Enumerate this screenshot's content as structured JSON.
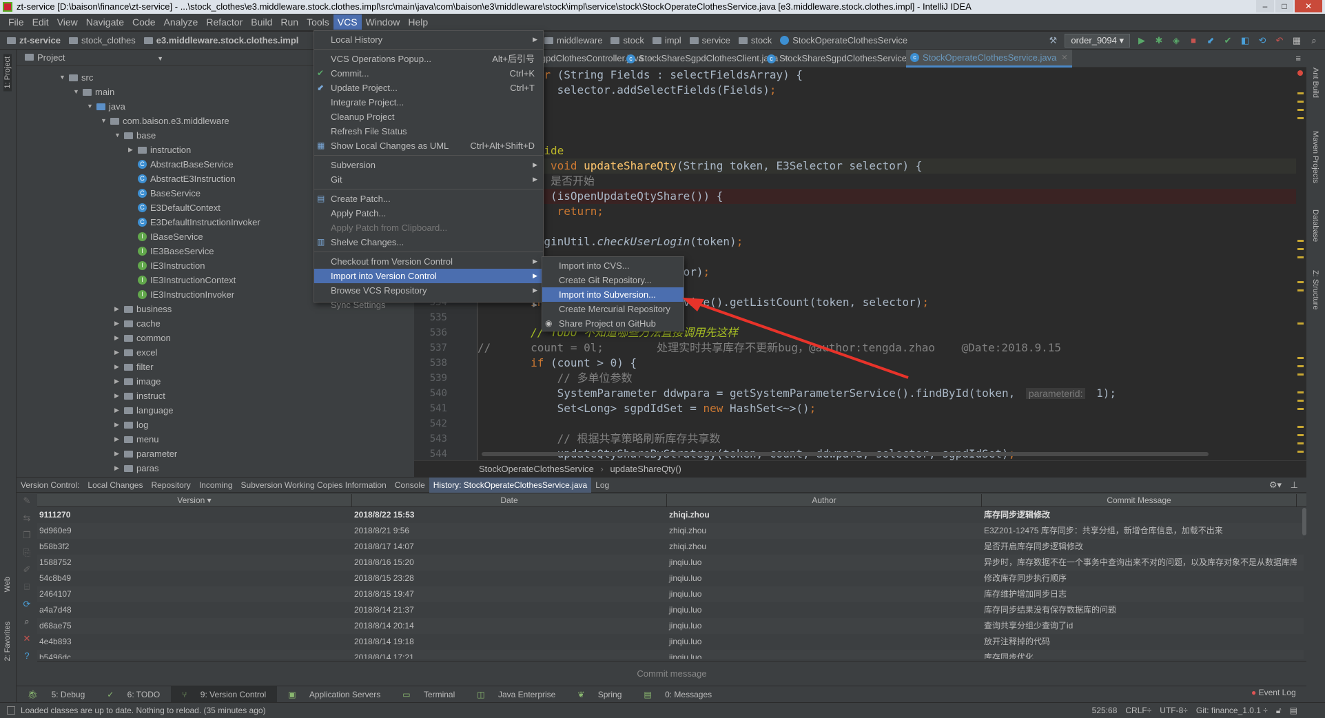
{
  "window": {
    "title": "zt-service [D:\\baison\\finance\\zt-service] - ...\\stock_clothes\\e3.middleware.stock.clothes.impl\\src\\main\\java\\com\\baison\\e3\\middleware\\stock\\impl\\service\\stock\\StockOperateClothesService.java [e3.middleware.stock.clothes.impl] - IntelliJ IDEA"
  },
  "menubar": [
    "File",
    "Edit",
    "View",
    "Navigate",
    "Code",
    "Analyze",
    "Refactor",
    "Build",
    "Run",
    "Tools",
    "VCS",
    "Window",
    "Help"
  ],
  "navbar": {
    "left": [
      "zt-service",
      "stock_clothes",
      "e3.middleware.stock.clothes.impl"
    ],
    "right": [
      "middleware",
      "stock",
      "impl",
      "service",
      "stock",
      "StockOperateClothesService"
    ],
    "run_config": "order_9094"
  },
  "project": {
    "header": "Project",
    "tool_label": "1: Project",
    "tree": [
      {
        "label": "src",
        "depth": 0,
        "arrow": "open",
        "icon": "folder"
      },
      {
        "label": "main",
        "depth": 1,
        "arrow": "open",
        "icon": "folder"
      },
      {
        "label": "java",
        "depth": 2,
        "arrow": "open",
        "icon": "folder-src"
      },
      {
        "label": "com.baison.e3.middleware",
        "depth": 3,
        "arrow": "open",
        "icon": "package"
      },
      {
        "label": "base",
        "depth": 4,
        "arrow": "open",
        "icon": "package"
      },
      {
        "label": "instruction",
        "depth": 5,
        "arrow": "closed",
        "icon": "package"
      },
      {
        "label": "AbstractBaseService",
        "depth": 5,
        "icon": "abstract-class"
      },
      {
        "label": "AbstractE3Instruction",
        "depth": 5,
        "icon": "abstract-class"
      },
      {
        "label": "BaseService",
        "depth": 5,
        "icon": "abstract-class"
      },
      {
        "label": "E3DefaultContext",
        "depth": 5,
        "icon": "class"
      },
      {
        "label": "E3DefaultInstructionInvoker",
        "depth": 5,
        "icon": "class"
      },
      {
        "label": "IBaseService",
        "depth": 5,
        "icon": "interface"
      },
      {
        "label": "IE3BaseService",
        "depth": 5,
        "icon": "interface"
      },
      {
        "label": "IE3Instruction",
        "depth": 5,
        "icon": "interface"
      },
      {
        "label": "IE3InstructionContext",
        "depth": 5,
        "icon": "interface"
      },
      {
        "label": "IE3InstructionInvoker",
        "depth": 5,
        "icon": "interface"
      },
      {
        "label": "business",
        "depth": 4,
        "arrow": "closed",
        "icon": "package"
      },
      {
        "label": "cache",
        "depth": 4,
        "arrow": "closed",
        "icon": "package"
      },
      {
        "label": "common",
        "depth": 4,
        "arrow": "closed",
        "icon": "package"
      },
      {
        "label": "excel",
        "depth": 4,
        "arrow": "closed",
        "icon": "package"
      },
      {
        "label": "filter",
        "depth": 4,
        "arrow": "closed",
        "icon": "package"
      },
      {
        "label": "image",
        "depth": 4,
        "arrow": "closed",
        "icon": "package"
      },
      {
        "label": "instruct",
        "depth": 4,
        "arrow": "closed",
        "icon": "package"
      },
      {
        "label": "language",
        "depth": 4,
        "arrow": "closed",
        "icon": "package"
      },
      {
        "label": "log",
        "depth": 4,
        "arrow": "closed",
        "icon": "package"
      },
      {
        "label": "menu",
        "depth": 4,
        "arrow": "closed",
        "icon": "package"
      },
      {
        "label": "parameter",
        "depth": 4,
        "arrow": "closed",
        "icon": "package"
      },
      {
        "label": "paras",
        "depth": 4,
        "arrow": "closed",
        "icon": "package"
      }
    ]
  },
  "editor": {
    "tabs": [
      {
        "label": "...ava",
        "active": false
      },
      {
        "label": "StockShareSgpdClothesController.java",
        "active": false
      },
      {
        "label": "StockShareSgpdClothesClient.java",
        "active": false
      },
      {
        "label": "StockShareSgpdClothesService.java",
        "active": false
      },
      {
        "label": "StockOperateClothesService.java",
        "active": true
      }
    ],
    "lines": [
      {
        "n": 519,
        "t": "        for (String Fields : selectFieldsArray) {"
      },
      {
        "n": 520,
        "t": "            selector.addSelectFields(Fields);"
      },
      {
        "n": 521,
        "t": "        }"
      },
      {
        "n": 522,
        "t": "    }"
      },
      {
        "n": 523,
        "t": ""
      },
      {
        "n": 524,
        "t": "    @Override"
      },
      {
        "n": 525,
        "t": "    public void updateShareQty(String token, E3Selector selector) {",
        "current": true
      },
      {
        "n": 526,
        "t": "        // 是否开始"
      },
      {
        "n": 527,
        "t": "        if (isOpenUpdateQtyShare()) {",
        "breakpoint": true
      },
      {
        "n": 528,
        "t": "            return;"
      },
      {
        "n": 529,
        "t": "        }"
      },
      {
        "n": 530,
        "t": "        LoginUtil.checkUserLogin(token);"
      },
      {
        "n": 531,
        "t": ""
      },
      {
        "n": 532,
        "t": "        validateSelector(selector);"
      },
      {
        "n": 533,
        "t": ""
      },
      {
        "n": 534,
        "t": "        int count = getStockService().getListCount(token, selector);"
      },
      {
        "n": 535,
        "t": ""
      },
      {
        "n": 536,
        "t": "        // TODO 不知道哪些方法直接调用先这样"
      },
      {
        "n": 537,
        "t": "//      count = 0l;        处理实时共享库存不更新bug，@author:tengda.zhao    @Date:2018.9.15"
      },
      {
        "n": 538,
        "t": "        if (count > 0) {"
      },
      {
        "n": 539,
        "t": "            // 多单位参数"
      },
      {
        "n": 540,
        "t": "            SystemParameter ddwpara = getSystemParameterService().findById(token, ",
        "hint": "parameterid:",
        "after": " 1);"
      },
      {
        "n": 541,
        "t": "            Set<Long> sgpdIdSet = new HashSet<~>();"
      },
      {
        "n": 542,
        "t": ""
      },
      {
        "n": 543,
        "t": "            // 根据共享策略刷新库存共享数"
      },
      {
        "n": 544,
        "t": "            updateQtyShareByStrategy(token, count, ddwpara, selector, sgpdIdSet);"
      }
    ],
    "breadcrumb": [
      "StockOperateClothesService",
      "updateShareQty()"
    ]
  },
  "right_strip": [
    "Ant Build",
    "Maven Projects",
    "Database",
    "Z: Structure"
  ],
  "vcs_menu": [
    {
      "label": "Local History",
      "submenu": true
    },
    {
      "sep": true
    },
    {
      "label": "VCS Operations Popup...",
      "shortcut": "Alt+后引号"
    },
    {
      "label": "Commit...",
      "shortcut": "Ctrl+K",
      "icon": "commit-icon"
    },
    {
      "label": "Update Project...",
      "shortcut": "Ctrl+T",
      "icon": "update-icon"
    },
    {
      "label": "Integrate Project..."
    },
    {
      "label": "Cleanup Project"
    },
    {
      "label": "Refresh File Status"
    },
    {
      "label": "Show Local Changes as UML",
      "shortcut": "Ctrl+Alt+Shift+D",
      "icon": "uml-icon"
    },
    {
      "sep": true
    },
    {
      "label": "Subversion",
      "submenu": true
    },
    {
      "label": "Git",
      "submenu": true
    },
    {
      "sep": true
    },
    {
      "label": "Create Patch...",
      "icon": "patch-icon"
    },
    {
      "label": "Apply Patch..."
    },
    {
      "label": "Apply Patch from Clipboard...",
      "disabled": true
    },
    {
      "label": "Shelve Changes...",
      "icon": "shelve-icon"
    },
    {
      "sep": true
    },
    {
      "label": "Checkout from Version Control",
      "submenu": true
    },
    {
      "label": "Import into Version Control",
      "submenu": true,
      "selected": true
    },
    {
      "label": "Browse VCS Repository",
      "submenu": true
    },
    {
      "label": "Sync Settings",
      "submenu": true,
      "disabled": true
    }
  ],
  "import_submenu": [
    {
      "label": "Import into CVS..."
    },
    {
      "label": "Create Git Repository..."
    },
    {
      "label": "Import into Subversion...",
      "selected": true
    },
    {
      "label": "Create Mercurial Repository"
    },
    {
      "label": "Share Project on GitHub",
      "icon": "github-icon"
    }
  ],
  "bottom": {
    "tabs": [
      {
        "label": "Version Control:"
      },
      {
        "label": "Local Changes"
      },
      {
        "label": "Repository"
      },
      {
        "label": "Incoming"
      },
      {
        "label": "Subversion Working Copies Information"
      },
      {
        "label": "Console"
      },
      {
        "label": "History: StockOperateClothesService.java",
        "active": true
      },
      {
        "label": "Log"
      }
    ],
    "columns": [
      "Version ▾",
      "Date",
      "Author",
      "Commit Message"
    ],
    "rows": [
      [
        "9111270",
        "2018/8/22 15:53",
        "zhiqi.zhou",
        "库存同步逻辑修改"
      ],
      [
        "9d960e9",
        "2018/8/21 9:56",
        "zhiqi.zhou",
        "E3Z201-12475 库存同步：共享分组，新增仓库信息，加载不出来"
      ],
      [
        "b58b3f2",
        "2018/8/17 14:07",
        "zhiqi.zhou",
        "是否开启库存同步逻辑修改"
      ],
      [
        "1588752",
        "2018/8/16 15:20",
        "jinqiu.luo",
        "异步时，库存数据不在一个事务中查询出来不对的问题，以及库存对象不是从数据库库"
      ],
      [
        "54c8b49",
        "2018/8/15 23:28",
        "jinqiu.luo",
        "修改库存同步执行顺序"
      ],
      [
        "2464107",
        "2018/8/15 19:47",
        "jinqiu.luo",
        "库存维护增加同步日志"
      ],
      [
        "a4a7d48",
        "2018/8/14 21:37",
        "jinqiu.luo",
        "库存同步结果没有保存数据库的问题"
      ],
      [
        "d68ae75",
        "2018/8/14 20:14",
        "jinqiu.luo",
        "查询共享分组少查询了id"
      ],
      [
        "4e4b893",
        "2018/8/14 19:18",
        "jinqiu.luo",
        "放开注释掉的代码"
      ],
      [
        "b5496dc",
        "2018/8/14 17:21",
        "jinqiu.luo",
        "库存同步优化"
      ]
    ],
    "commit_message": "Commit message"
  },
  "tool_windows": [
    {
      "label": "5: Debug"
    },
    {
      "label": "6: TODO"
    },
    {
      "label": "9: Version Control",
      "active": true
    },
    {
      "label": "Application Servers"
    },
    {
      "label": "Terminal"
    },
    {
      "label": "Java Enterprise"
    },
    {
      "label": "Spring"
    },
    {
      "label": "0: Messages"
    }
  ],
  "event_log": "Event Log",
  "left_strip": [
    "1: Project",
    "Web",
    "2: Favorites"
  ],
  "status": {
    "message": "Loaded classes are up to date. Nothing to reload. (35 minutes ago)",
    "position": "525:68",
    "line_sep": "CRLF÷",
    "encoding": "UTF-8÷",
    "git": "Git: finance_1.0.1 ÷"
  },
  "colors": {
    "accent": "#4b6eaf",
    "panel": "#3c3f41",
    "editor_bg": "#2b2b2b",
    "annotation_arrow": "#e8332a"
  }
}
